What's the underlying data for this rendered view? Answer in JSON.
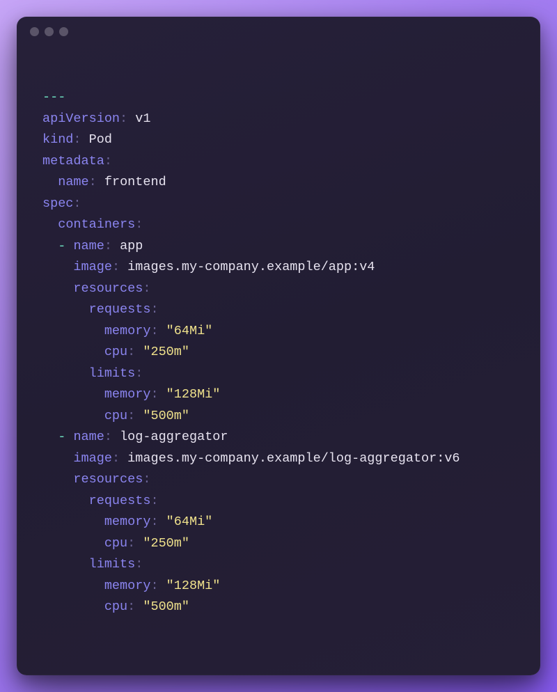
{
  "window": {
    "traffic_light_count": 3
  },
  "code": {
    "doc_sep": "---",
    "kv": {
      "apiVersion": {
        "key": "apiVersion",
        "value": "v1"
      },
      "kind": {
        "key": "kind",
        "value": "Pod"
      },
      "metadata": {
        "key": "metadata"
      },
      "metadata_name": {
        "key": "name",
        "value": "frontend"
      },
      "spec": {
        "key": "spec"
      },
      "containers": {
        "key": "containers"
      },
      "c0": {
        "name": {
          "key": "name",
          "value": "app"
        },
        "image": {
          "key": "image",
          "value": "images.my-company.example/app:v4"
        },
        "resources": {
          "key": "resources"
        },
        "requests": {
          "key": "requests"
        },
        "req_mem": {
          "key": "memory",
          "value": "\"64Mi\""
        },
        "req_cpu": {
          "key": "cpu",
          "value": "\"250m\""
        },
        "limits": {
          "key": "limits"
        },
        "lim_mem": {
          "key": "memory",
          "value": "\"128Mi\""
        },
        "lim_cpu": {
          "key": "cpu",
          "value": "\"500m\""
        }
      },
      "c1": {
        "name": {
          "key": "name",
          "value": "log-aggregator"
        },
        "image": {
          "key": "image",
          "value": "images.my-company.example/log-aggregator:v6"
        },
        "resources": {
          "key": "resources"
        },
        "requests": {
          "key": "requests"
        },
        "req_mem": {
          "key": "memory",
          "value": "\"64Mi\""
        },
        "req_cpu": {
          "key": "cpu",
          "value": "\"250m\""
        },
        "limits": {
          "key": "limits"
        },
        "lim_mem": {
          "key": "memory",
          "value": "\"128Mi\""
        },
        "lim_cpu": {
          "key": "cpu",
          "value": "\"500m\""
        }
      }
    },
    "colon": ":",
    "dash": "-"
  }
}
